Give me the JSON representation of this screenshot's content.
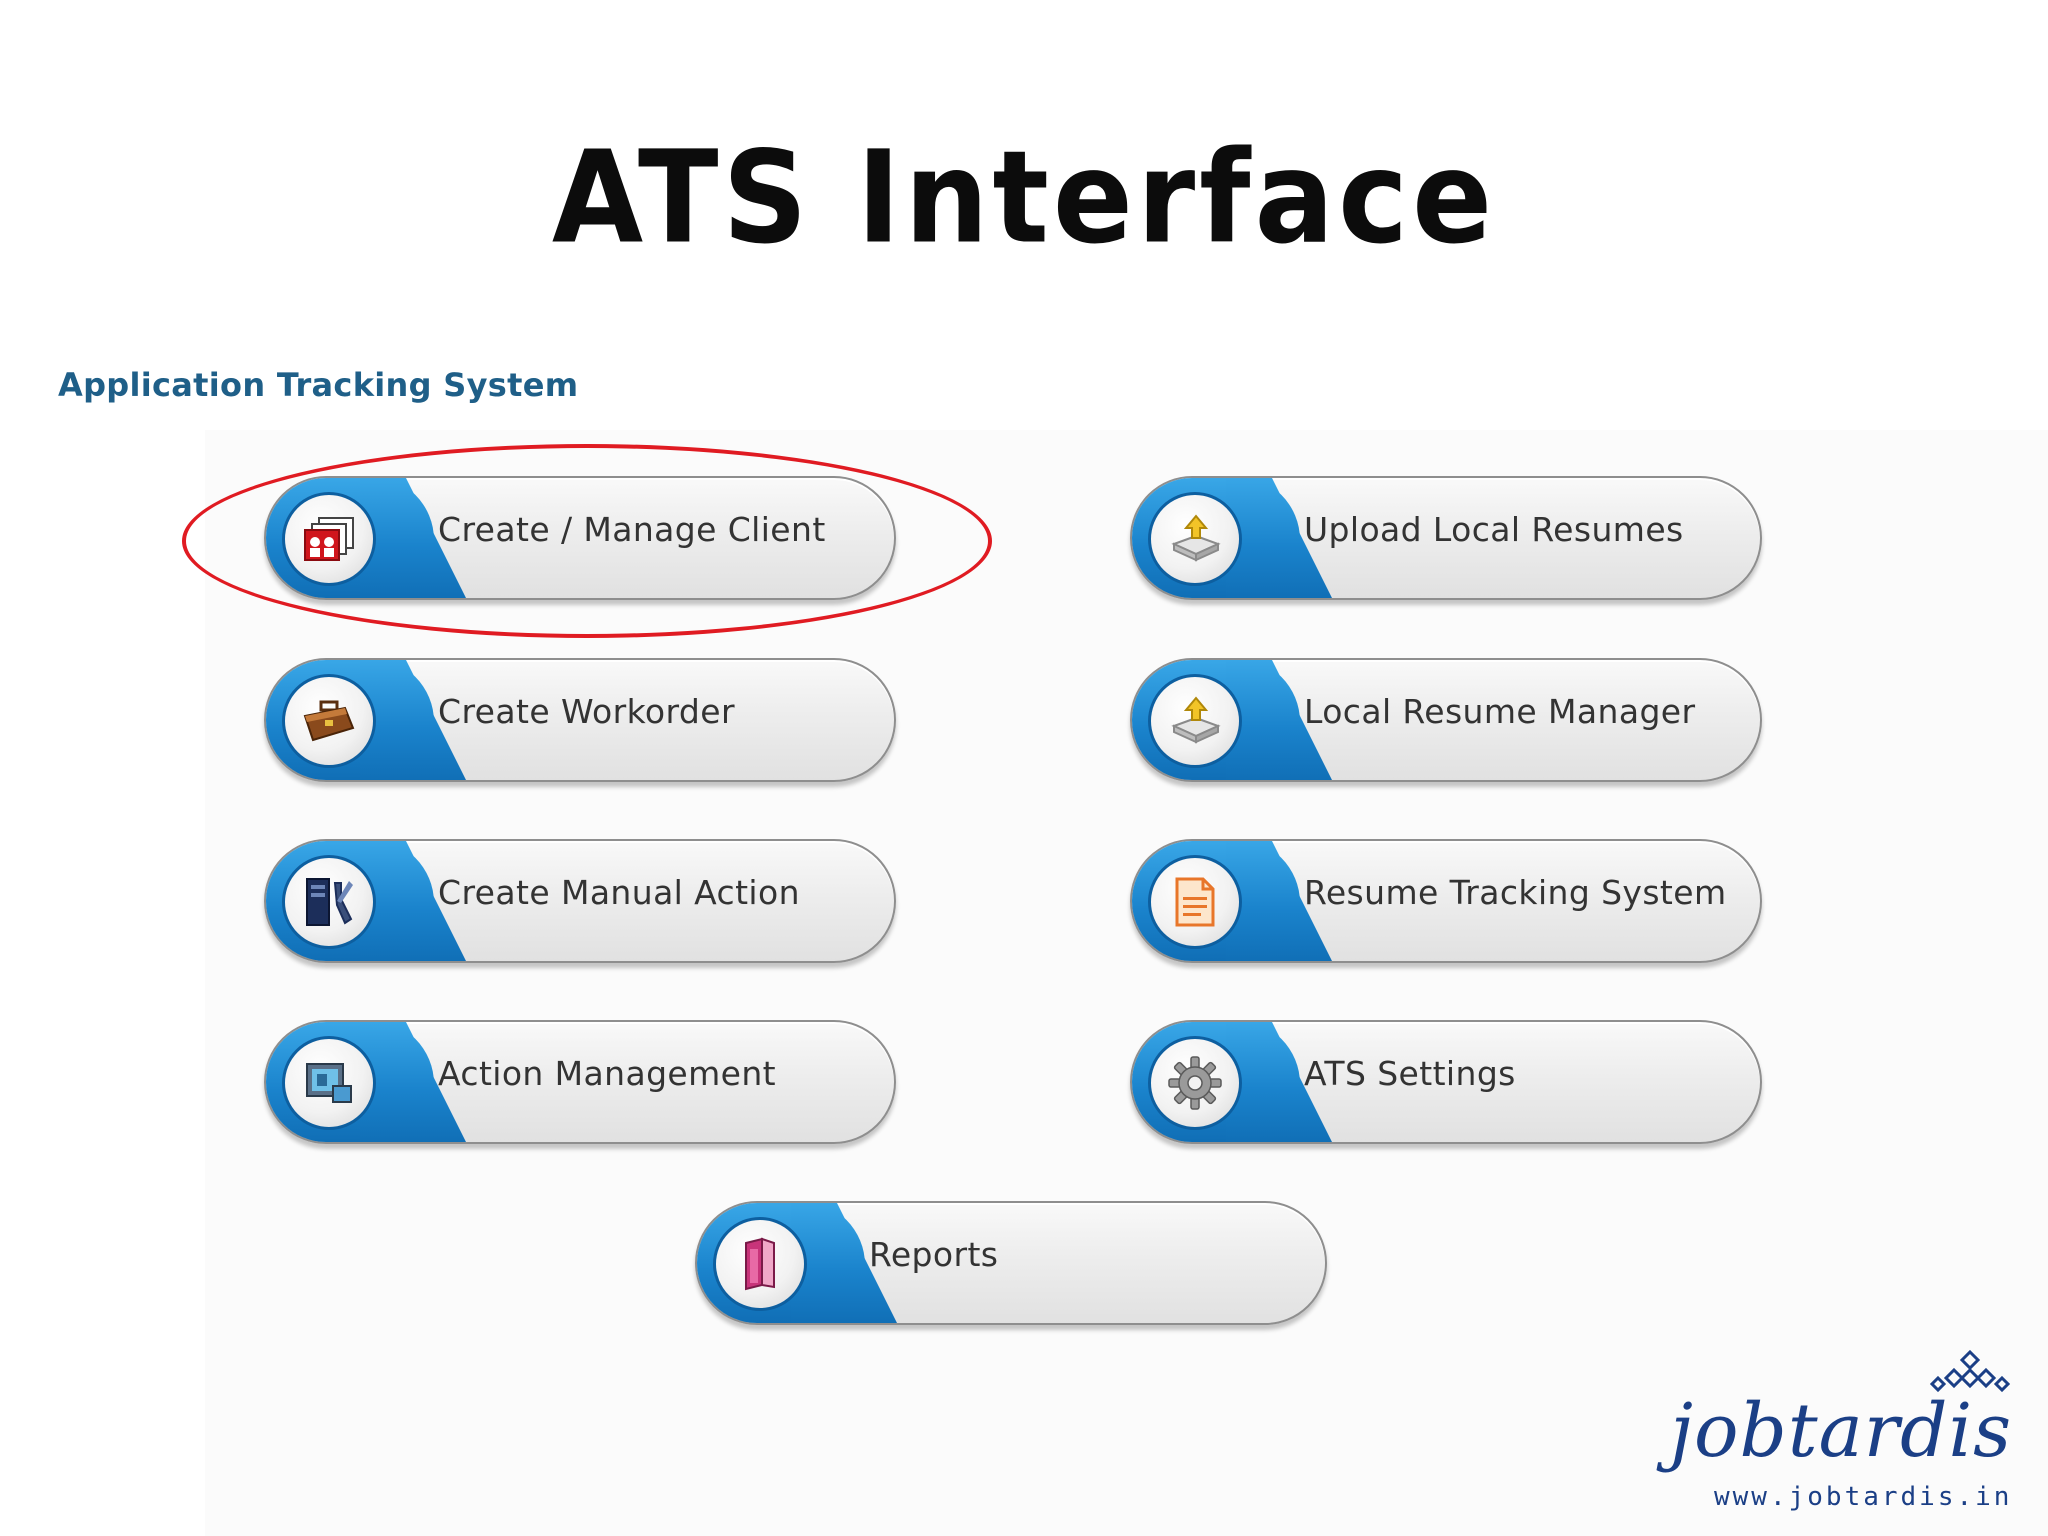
{
  "slide": {
    "title": "ATS Interface"
  },
  "app": {
    "section_title": "Application Tracking System"
  },
  "buttons": [
    {
      "label": "Create / Manage Client",
      "icon": "client-icon"
    },
    {
      "label": "Upload Local Resumes",
      "icon": "upload-icon"
    },
    {
      "label": "Create Workorder",
      "icon": "briefcase-icon"
    },
    {
      "label": "Local Resume Manager",
      "icon": "upload-icon"
    },
    {
      "label": "Create Manual Action",
      "icon": "tools-icon"
    },
    {
      "label": "Resume Tracking System",
      "icon": "document-icon"
    },
    {
      "label": "Action Management",
      "icon": "monitor-icon"
    },
    {
      "label": "ATS Settings",
      "icon": "gear-icon"
    },
    {
      "label": "Reports",
      "icon": "book-icon"
    }
  ],
  "colors": {
    "accent_blue": "#1a83cc",
    "annotation_red": "#e01b22",
    "section_title": "#1f5f88",
    "logo_navy": "#1b3f86"
  },
  "logo": {
    "word": "jobtardis",
    "url": "www.jobtardis.in"
  }
}
